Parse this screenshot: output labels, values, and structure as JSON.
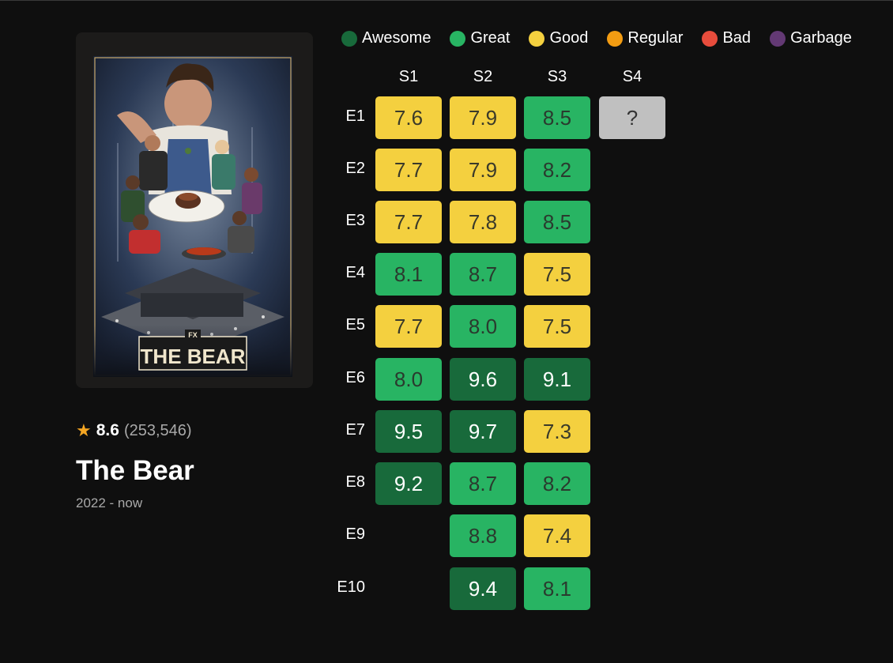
{
  "colors": {
    "awesome": "#186a3b",
    "great": "#28b463",
    "good": "#f4d03f",
    "regular": "#f39c12",
    "bad": "#e74c3c",
    "garbage": "#633974",
    "unknown": "#c0c0c0"
  },
  "legend": [
    {
      "label": "Awesome",
      "key": "awesome"
    },
    {
      "label": "Great",
      "key": "great"
    },
    {
      "label": "Good",
      "key": "good"
    },
    {
      "label": "Regular",
      "key": "regular"
    },
    {
      "label": "Bad",
      "key": "bad"
    },
    {
      "label": "Garbage",
      "key": "garbage"
    }
  ],
  "show": {
    "poster_text": "THE BEAR",
    "poster_badge": "FX",
    "rating": "8.6",
    "votes": "(253,546)",
    "title": "The Bear",
    "years": "2022 - now"
  },
  "seasons": [
    "S1",
    "S2",
    "S3",
    "S4"
  ],
  "episodes": [
    "E1",
    "E2",
    "E3",
    "E4",
    "E5",
    "E6",
    "E7",
    "E8",
    "E9",
    "E10"
  ],
  "grid": [
    [
      {
        "v": "7.6",
        "c": "good"
      },
      {
        "v": "7.9",
        "c": "good"
      },
      {
        "v": "8.5",
        "c": "great"
      },
      {
        "v": "?",
        "c": "unknown"
      }
    ],
    [
      {
        "v": "7.7",
        "c": "good"
      },
      {
        "v": "7.9",
        "c": "good"
      },
      {
        "v": "8.2",
        "c": "great"
      },
      null
    ],
    [
      {
        "v": "7.7",
        "c": "good"
      },
      {
        "v": "7.8",
        "c": "good"
      },
      {
        "v": "8.5",
        "c": "great"
      },
      null
    ],
    [
      {
        "v": "8.1",
        "c": "great"
      },
      {
        "v": "8.7",
        "c": "great"
      },
      {
        "v": "7.5",
        "c": "good"
      },
      null
    ],
    [
      {
        "v": "7.7",
        "c": "good"
      },
      {
        "v": "8.0",
        "c": "great"
      },
      {
        "v": "7.5",
        "c": "good"
      },
      null
    ],
    [
      {
        "v": "8.0",
        "c": "great"
      },
      {
        "v": "9.6",
        "c": "awesome"
      },
      {
        "v": "9.1",
        "c": "awesome"
      },
      null
    ],
    [
      {
        "v": "9.5",
        "c": "awesome"
      },
      {
        "v": "9.7",
        "c": "awesome"
      },
      {
        "v": "7.3",
        "c": "good"
      },
      null
    ],
    [
      {
        "v": "9.2",
        "c": "awesome"
      },
      {
        "v": "8.7",
        "c": "great"
      },
      {
        "v": "8.2",
        "c": "great"
      },
      null
    ],
    [
      null,
      {
        "v": "8.8",
        "c": "great"
      },
      {
        "v": "7.4",
        "c": "good"
      },
      null
    ],
    [
      null,
      {
        "v": "9.4",
        "c": "awesome"
      },
      {
        "v": "8.1",
        "c": "great"
      },
      null
    ]
  ]
}
